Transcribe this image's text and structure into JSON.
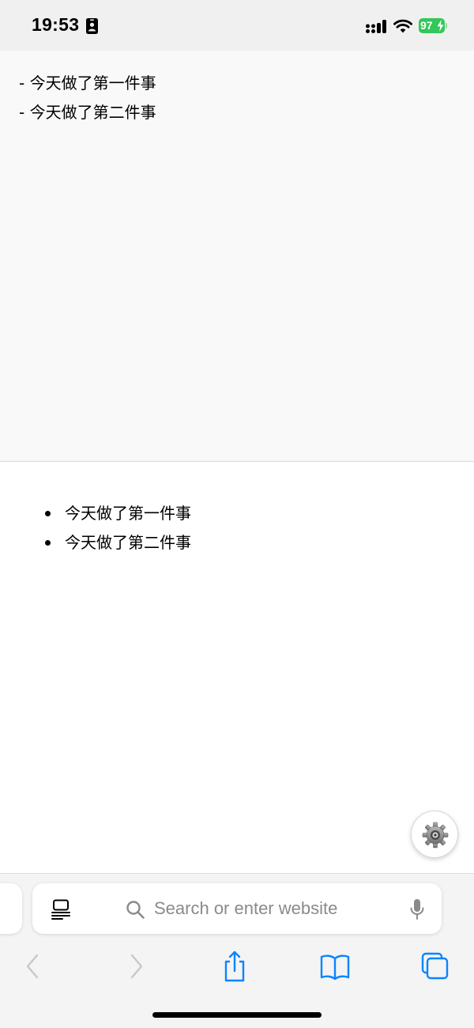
{
  "status_bar": {
    "time": "19:53",
    "battery_level": "97",
    "battery_color": "#34c759"
  },
  "source_editor": {
    "lines": [
      "- 今天做了第一件事",
      "- 今天做了第二件事"
    ]
  },
  "preview": {
    "items": [
      "今天做了第一件事",
      "今天做了第二件事"
    ]
  },
  "settings_button": {
    "icon": "gear-icon"
  },
  "safari": {
    "address_placeholder": "Search or enter website",
    "accent_color": "#0a84ff",
    "disabled_color": "#c7c7cc"
  }
}
